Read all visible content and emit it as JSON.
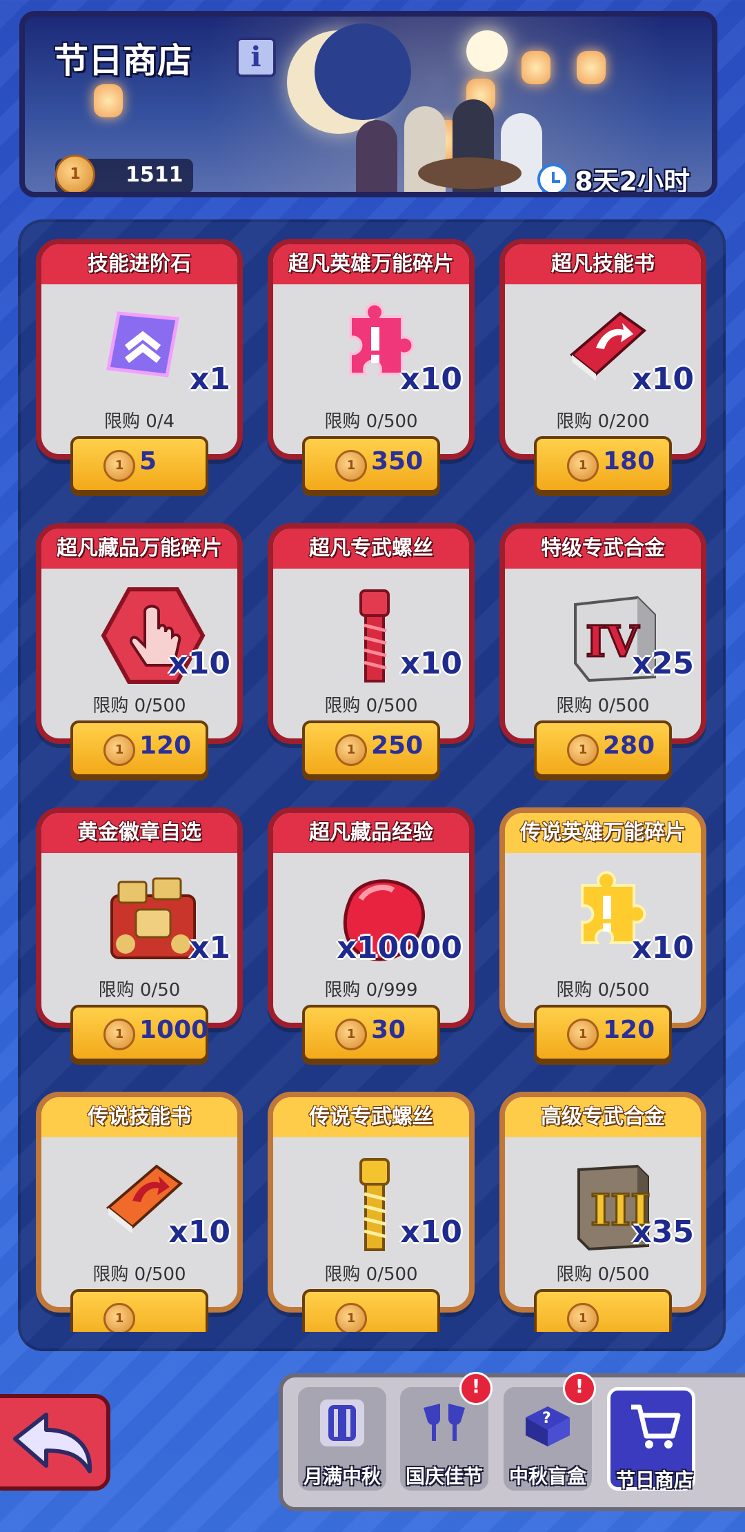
{
  "header": {
    "title": "节日商店",
    "info_label": "i",
    "currency": "1511",
    "timer": "8天2小时"
  },
  "shop": {
    "items": [
      {
        "name": "技能进阶石",
        "icon": "skill-stone-icon",
        "qty": "x1",
        "limit": "限购 0/4",
        "price": "5",
        "rarity": "red"
      },
      {
        "name": "超凡英雄万能碎片",
        "icon": "pink-puzzle-icon",
        "qty": "x10",
        "limit": "限购 0/500",
        "price": "350",
        "rarity": "red"
      },
      {
        "name": "超凡技能书",
        "icon": "red-book-icon",
        "qty": "x10",
        "limit": "限购 0/200",
        "price": "180",
        "rarity": "red"
      },
      {
        "name": "超凡藏品万能碎片",
        "icon": "red-hexagon-hand-icon",
        "qty": "x10",
        "limit": "限购 0/500",
        "price": "120",
        "rarity": "red"
      },
      {
        "name": "超凡专武螺丝",
        "icon": "red-screw-icon",
        "qty": "x10",
        "limit": "限购 0/500",
        "price": "250",
        "rarity": "red"
      },
      {
        "name": "特级专武合金",
        "icon": "iv-alloy-block-icon",
        "qty": "x25",
        "limit": "限购 0/500",
        "price": "280",
        "rarity": "red"
      },
      {
        "name": "黄金徽章自选",
        "icon": "gold-badge-pile-icon",
        "qty": "x1",
        "limit": "限购 0/50",
        "price": "1000",
        "rarity": "red"
      },
      {
        "name": "超凡藏品经验",
        "icon": "red-gem-blob-icon",
        "qty": "x10000",
        "limit": "限购 0/999",
        "price": "30",
        "rarity": "red"
      },
      {
        "name": "传说英雄万能碎片",
        "icon": "gold-puzzle-icon",
        "qty": "x10",
        "limit": "限购 0/500",
        "price": "120",
        "rarity": "gold"
      },
      {
        "name": "传说技能书",
        "icon": "orange-book-icon",
        "qty": "x10",
        "limit": "限购 0/500",
        "price": "",
        "rarity": "gold"
      },
      {
        "name": "传说专武螺丝",
        "icon": "gold-screw-icon",
        "qty": "x10",
        "limit": "限购 0/500",
        "price": "",
        "rarity": "gold"
      },
      {
        "name": "高级专武合金",
        "icon": "iii-alloy-block-icon",
        "qty": "x35",
        "limit": "限购 0/500",
        "price": "",
        "rarity": "gold"
      }
    ]
  },
  "tabs": [
    {
      "label": "月满中秋",
      "icon": "moon-gate-icon",
      "alert": false,
      "active": false
    },
    {
      "label": "国庆佳节",
      "icon": "cheers-glasses-icon",
      "alert": true,
      "active": false
    },
    {
      "label": "中秋盲盒",
      "icon": "mystery-box-icon",
      "alert": true,
      "active": false
    },
    {
      "label": "节日商店",
      "icon": "shopping-cart-icon",
      "alert": false,
      "active": true
    }
  ],
  "alert_mark": "!",
  "colors": {
    "red_frame": "#9e1e2e",
    "red_header": "#e03148",
    "gold_frame": "#c0783a",
    "gold_header": "#ffcc4a",
    "button": "#f3a91a",
    "price_text": "#2a2f9a"
  }
}
